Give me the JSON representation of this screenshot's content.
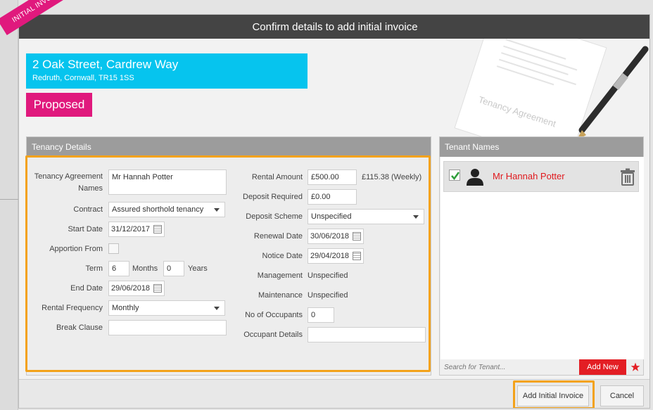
{
  "ribbon": {
    "label": "INITIAL INVOICE"
  },
  "modal": {
    "title": "Confirm details to add initial invoice"
  },
  "property": {
    "address_line1": "2 Oak Street, Cardrew Way",
    "address_line2": "Redruth, Cornwall, TR15 1SS",
    "status": "Proposed"
  },
  "decoration": {
    "document_text": "Tenancy Agreement"
  },
  "tenancy": {
    "panel_title": "Tenancy Details",
    "tenancy_agreement_names_label": "Tenancy Agreement Names",
    "tenancy_agreement_names_value": "Mr Hannah Potter",
    "contract_label": "Contract",
    "contract_value": "Assured shorthold tenancy",
    "start_date_label": "Start Date",
    "start_date_value": "31/12/2017",
    "apportion_from_label": "Apportion From",
    "term_label": "Term",
    "term_months_value": "6",
    "months_label": "Months",
    "term_years_value": "0",
    "years_label": "Years",
    "end_date_label": "End Date",
    "end_date_value": "29/06/2018",
    "rental_frequency_label": "Rental Frequency",
    "rental_frequency_value": "Monthly",
    "break_clause_label": "Break Clause",
    "break_clause_value": "",
    "rental_amount_label": "Rental Amount",
    "rental_amount_value": "£500.00",
    "weekly_amount": "£115.38 (Weekly)",
    "deposit_required_label": "Deposit Required",
    "deposit_required_value": "£0.00",
    "deposit_scheme_label": "Deposit Scheme",
    "deposit_scheme_value": "Unspecified",
    "renewal_date_label": "Renewal Date",
    "renewal_date_value": "30/06/2018",
    "notice_date_label": "Notice Date",
    "notice_date_value": "29/04/2018",
    "management_label": "Management",
    "management_value": "Unspecified",
    "maintenance_label": "Maintenance",
    "maintenance_value": "Unspecified",
    "no_of_occupants_label": "No of Occupants",
    "no_of_occupants_value": "0",
    "occupant_details_label": "Occupant Details",
    "occupant_details_value": ""
  },
  "tenants": {
    "panel_title": "Tenant Names",
    "items": [
      {
        "name": "Mr Hannah Potter"
      }
    ],
    "search_placeholder": "Search for Tenant...",
    "add_new_label": "Add New"
  },
  "footer": {
    "add_initial_invoice_label": "Add Initial Invoice",
    "cancel_label": "Cancel"
  },
  "colors": {
    "header": "#444444",
    "address_bg": "#06c4ee",
    "status_bg": "#e0197d",
    "highlight": "#f3a21a",
    "tenant_name": "#e0191e",
    "add_new_bg": "#e31e24"
  },
  "icons": [
    "calendar-icon",
    "chevron-down-icon",
    "check-icon",
    "person-icon",
    "trash-icon",
    "star-icon",
    "pen-icon"
  ]
}
